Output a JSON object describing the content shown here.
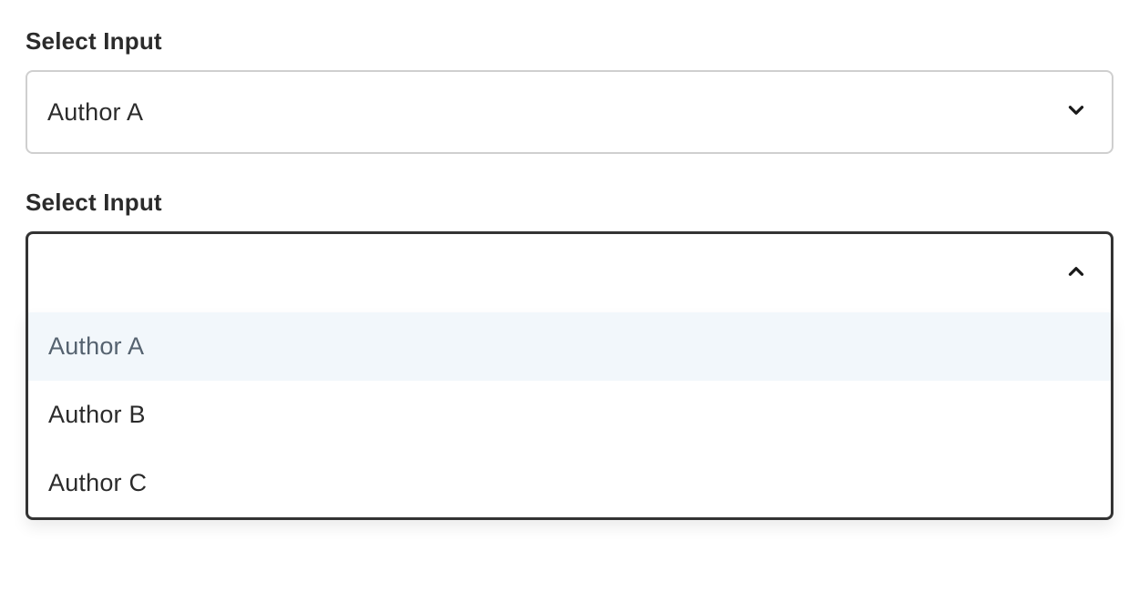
{
  "select_closed": {
    "label": "Select Input",
    "value": "Author A"
  },
  "select_open": {
    "label": "Select Input",
    "value": "",
    "options": [
      {
        "label": "Author A"
      },
      {
        "label": "Author B"
      },
      {
        "label": "Author C"
      }
    ]
  }
}
